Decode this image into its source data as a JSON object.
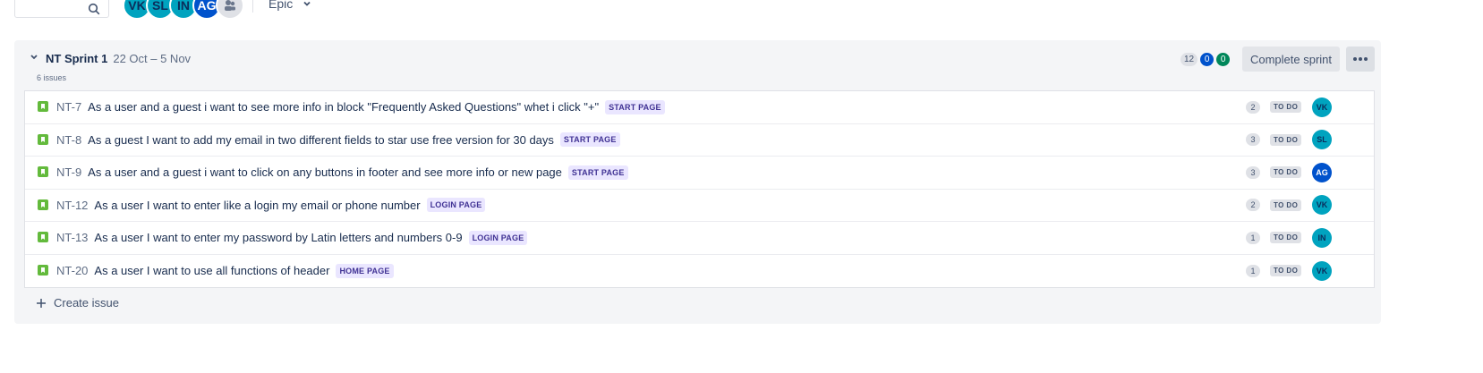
{
  "filters": {
    "avatars": [
      {
        "initials": "VK",
        "color": "#00a3bf"
      },
      {
        "initials": "SL",
        "color": "#00a3bf"
      },
      {
        "initials": "IN",
        "color": "#00a3bf"
      },
      {
        "initials": "AG",
        "color": "#0052cc"
      }
    ],
    "epic_label": "Epic"
  },
  "sprint": {
    "name": "NT Sprint 1",
    "dates": "22 Oct – 5 Nov",
    "issue_count": "6 issues",
    "stats": {
      "todo": "12",
      "in_progress": "0",
      "done": "0"
    },
    "complete_label": "Complete sprint",
    "create_issue_label": "Create issue"
  },
  "issues": [
    {
      "key": "NT-7",
      "summary": "As a user and a guest i want to see more info in block \"Frequently Asked Questions\" whet i click \"+\"",
      "epic": "START PAGE",
      "points": "2",
      "status": "TO DO",
      "assignee": "VK",
      "assignee_color": "#00a3bf"
    },
    {
      "key": "NT-8",
      "summary": "As a guest I want to add my email in two different fields to star use free version for 30 days",
      "epic": "START PAGE",
      "points": "3",
      "status": "TO DO",
      "assignee": "SL",
      "assignee_color": "#00a3bf"
    },
    {
      "key": "NT-9",
      "summary": "As a user and a guest i want to click on any buttons in footer and see more info or new page",
      "epic": "START PAGE",
      "points": "3",
      "status": "TO DO",
      "assignee": "AG",
      "assignee_color": "#0052cc"
    },
    {
      "key": "NT-12",
      "summary": "As a user I want to enter like a login my email or phone number",
      "epic": "LOGIN PAGE",
      "points": "2",
      "status": "TO DO",
      "assignee": "VK",
      "assignee_color": "#00a3bf"
    },
    {
      "key": "NT-13",
      "summary": "As a user I want to enter my password by Latin letters and numbers 0-9",
      "epic": "LOGIN PAGE",
      "points": "1",
      "status": "TO DO",
      "assignee": "IN",
      "assignee_color": "#00a3bf"
    },
    {
      "key": "NT-20",
      "summary": "As a user I want to use all functions of header",
      "epic": "HOME PAGE",
      "points": "1",
      "status": "TO DO",
      "assignee": "VK",
      "assignee_color": "#00a3bf"
    }
  ]
}
